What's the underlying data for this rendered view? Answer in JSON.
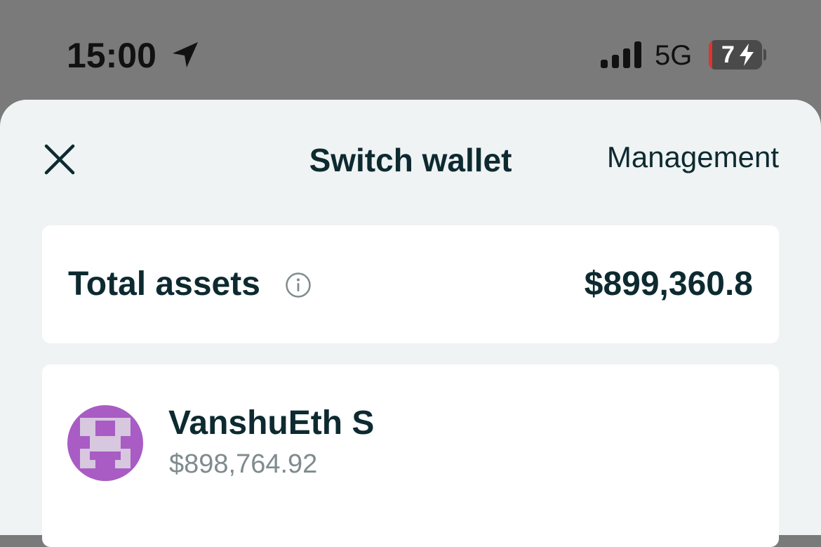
{
  "status_bar": {
    "time": "15:00",
    "network": "5G",
    "battery": "7"
  },
  "sheet": {
    "title": "Switch wallet",
    "management_label": "Management"
  },
  "total_assets": {
    "label": "Total assets",
    "value": "$899,360.8"
  },
  "wallets": [
    {
      "name": "VanshuEth S",
      "balance": "$898,764.92",
      "avatar_colors": [
        "#a85cc4",
        "#d7c7df"
      ]
    }
  ],
  "colors": {
    "backdrop": "#7a7a7a",
    "sheet_bg": "#eff3f3",
    "primary_text": "#0d2a30",
    "secondary_text": "#7f8b8e",
    "battery_low": "#e0342b"
  }
}
